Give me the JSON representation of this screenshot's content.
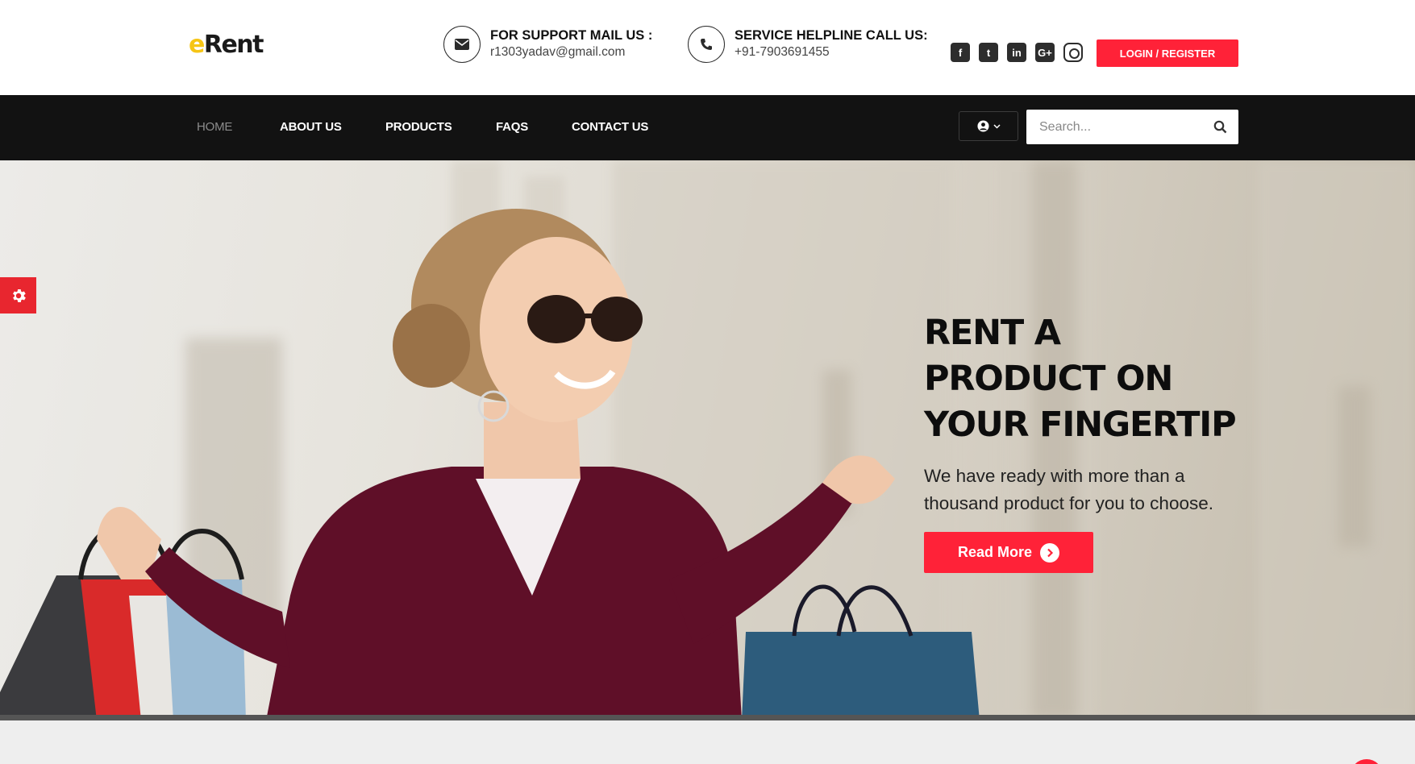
{
  "header": {
    "logo": {
      "prefix": "e",
      "rest": "Rent"
    },
    "support": {
      "label": "FOR SUPPORT MAIL US :",
      "value": "r1303yadav@gmail.com",
      "icon": "envelope-icon"
    },
    "helpline": {
      "label": "SERVICE HELPLINE CALL US:",
      "value": "+91-7903691455",
      "icon": "phone-icon"
    },
    "social": [
      {
        "name": "facebook-icon",
        "glyph": "f"
      },
      {
        "name": "twitter-icon",
        "glyph": "t"
      },
      {
        "name": "linkedin-icon",
        "glyph": "in"
      },
      {
        "name": "google-plus-icon",
        "glyph": "G+"
      },
      {
        "name": "instagram-icon",
        "glyph": ""
      }
    ],
    "login_label": "LOGIN / REGISTER"
  },
  "nav": {
    "items": [
      {
        "label": "HOME",
        "active": true
      },
      {
        "label": "ABOUT US"
      },
      {
        "label": "PRODUCTS"
      },
      {
        "label": "FAQS"
      },
      {
        "label": "CONTACT US"
      }
    ],
    "search_placeholder": "Search..."
  },
  "hero": {
    "title_line1": "RENT A",
    "title_line2": "PRODUCT ON",
    "title_line3": "YOUR FINGERTIP",
    "subtitle": "We have ready with more than a thousand product for you to choose.",
    "button_label": "Read More"
  },
  "colors": {
    "accent": "#ff2238",
    "logo_accent": "#f6c515",
    "nav_bg": "#121212"
  }
}
